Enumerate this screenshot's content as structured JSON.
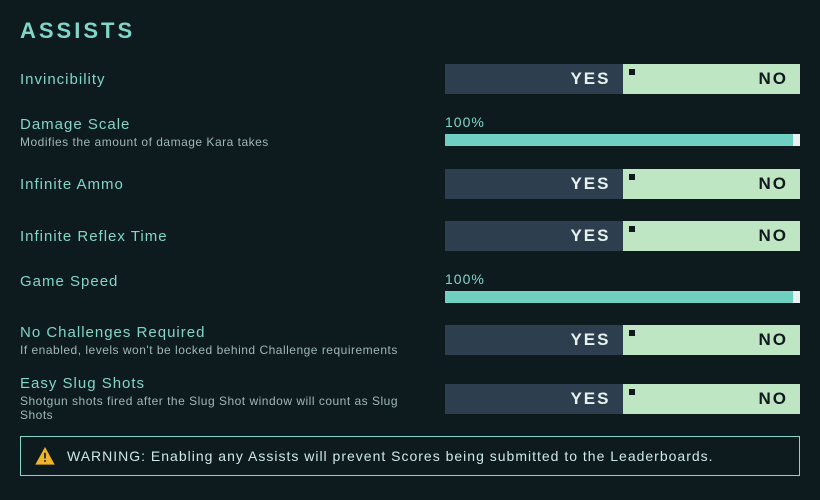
{
  "title": "ASSISTS",
  "options": {
    "invincibility": {
      "label": "Invincibility",
      "yes": "YES",
      "no": "NO",
      "selected": "no"
    },
    "damage_scale": {
      "label": "Damage Scale",
      "desc": "Modifies the amount of damage Kara takes",
      "value_text": "100%",
      "percent": 100
    },
    "infinite_ammo": {
      "label": "Infinite Ammo",
      "yes": "YES",
      "no": "NO",
      "selected": "no"
    },
    "infinite_reflex": {
      "label": "Infinite Reflex Time",
      "yes": "YES",
      "no": "NO",
      "selected": "no"
    },
    "game_speed": {
      "label": "Game Speed",
      "value_text": "100%",
      "percent": 100
    },
    "no_challenges": {
      "label": "No Challenges Required",
      "desc": "If enabled, levels won't be locked behind Challenge requirements",
      "yes": "YES",
      "no": "NO",
      "selected": "no"
    },
    "easy_slug": {
      "label": "Easy Slug Shots",
      "desc": "Shotgun shots fired after the Slug Shot window will count as Slug Shots",
      "yes": "YES",
      "no": "NO",
      "selected": "no"
    }
  },
  "warning": "WARNING: Enabling any Assists will prevent Scores being submitted to the Leaderboards.",
  "colors": {
    "bg": "#0d1b1e",
    "accent": "#7fd6c9",
    "toggle_off_bg": "#2d3f4e",
    "toggle_on_bg": "#bfe6c3"
  }
}
